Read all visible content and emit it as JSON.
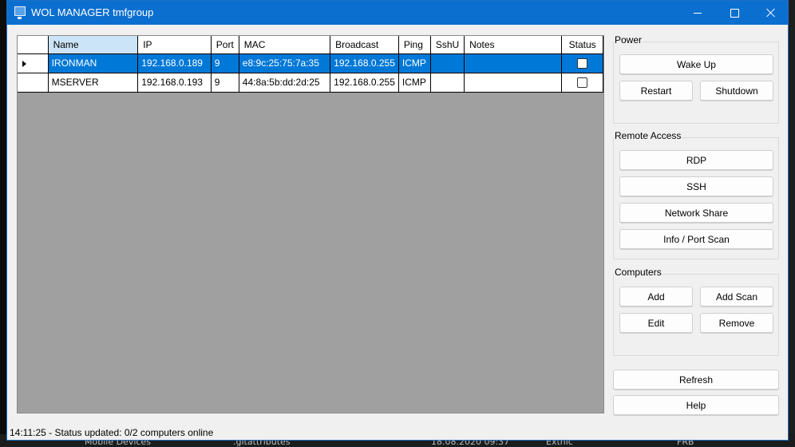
{
  "window": {
    "title": "WOL MANAGER tmfgroup"
  },
  "grid": {
    "columns": [
      "Name",
      "IP",
      "Port",
      "MAC",
      "Broadcast",
      "Ping",
      "SshU",
      "Notes",
      "Status"
    ],
    "sorted_column": "Name",
    "rows": [
      {
        "name": "IRONMAN",
        "ip": "192.168.0.189",
        "port": "9",
        "mac": "e8:9c:25:75:7a:35",
        "broadcast": "192.168.0.255",
        "ping": "ICMP",
        "sshu": "",
        "notes": "",
        "status": false,
        "selected": true
      },
      {
        "name": "MSERVER",
        "ip": "192.168.0.193",
        "port": "9",
        "mac": "44:8a:5b:dd:2d:25",
        "broadcast": "192.168.0.255",
        "ping": "ICMP",
        "sshu": "",
        "notes": "",
        "status": false,
        "selected": false
      }
    ]
  },
  "power": {
    "title": "Power",
    "wake_up": "Wake Up",
    "restart": "Restart",
    "shutdown": "Shutdown"
  },
  "remote": {
    "title": "Remote Access",
    "rdp": "RDP",
    "ssh": "SSH",
    "network_share": "Network Share",
    "info_port_scan": "Info / Port Scan"
  },
  "computers": {
    "title": "Computers",
    "add": "Add",
    "add_scan": "Add Scan",
    "edit": "Edit",
    "remove": "Remove"
  },
  "refresh": "Refresh",
  "help": "Help",
  "status_bar": "14:11:25 - Status updated: 0/2 computers online",
  "background": {
    "bottom_items": [
      "Mobile Devices",
      ".gitattributes",
      "18.08.2020 09:37",
      "Extnic",
      "FRB"
    ]
  },
  "colors": {
    "titlebar": "#0b6fd0",
    "selection": "#0078d7",
    "sorted_header": "#cce4f7",
    "grid_empty": "#a0a0a0"
  }
}
